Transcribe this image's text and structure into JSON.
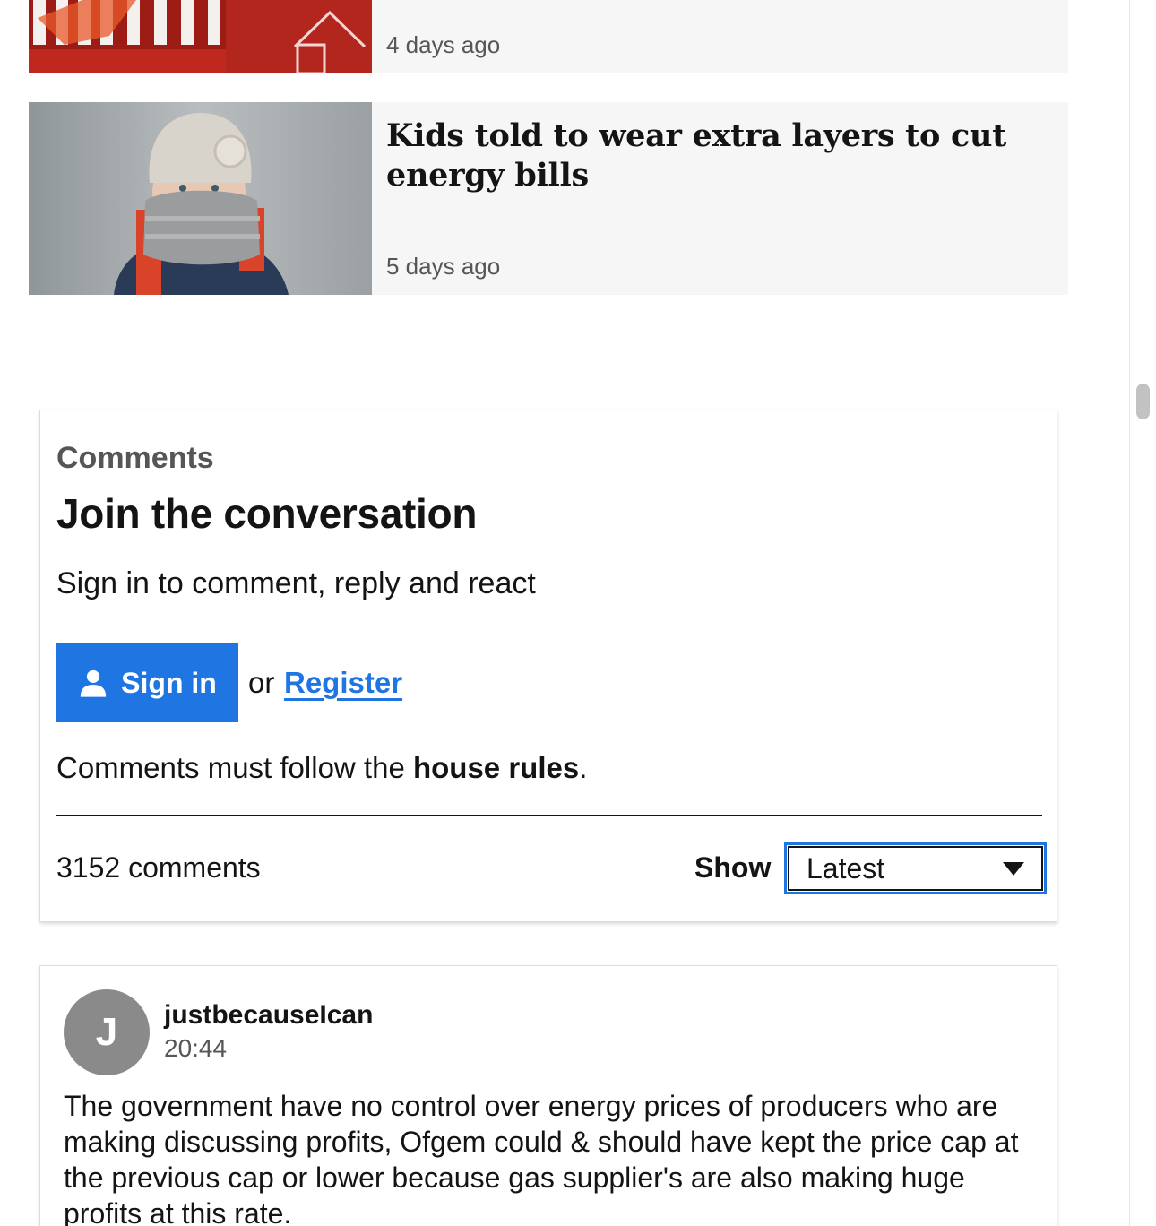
{
  "stories": [
    {
      "title": "",
      "time": "4 days ago",
      "image": "red-price-graphic-image"
    },
    {
      "title": "Kids told to wear extra layers to cut energy bills",
      "time": "5 days ago",
      "image": "child-in-hat-and-scarf-image"
    }
  ],
  "comments": {
    "eyebrow": "Comments",
    "title": "Join the conversation",
    "subtitle": "Sign in to comment, reply and react",
    "signin_label": "Sign in",
    "or_text": "or",
    "register_label": "Register",
    "rules_prefix": "Comments must follow the ",
    "rules_link": "house rules",
    "rules_suffix": ".",
    "count": "3152 comments",
    "show_label": "Show",
    "sort_selected": "Latest"
  },
  "comment_list": [
    {
      "avatar_letter": "J",
      "user": "justbecauseIcan",
      "time": "20:44",
      "text": "The government have no control over energy prices of producers who are making discussing profits, Ofgem could & should have kept the price cap at the previous cap or lower because gas supplier's are also making huge profits at this rate."
    }
  ],
  "colors": {
    "accent": "#1f76e3",
    "card_bg": "#f6f6f6",
    "text": "#141414",
    "muted": "#545658",
    "avatar": "#8a8a8a"
  }
}
